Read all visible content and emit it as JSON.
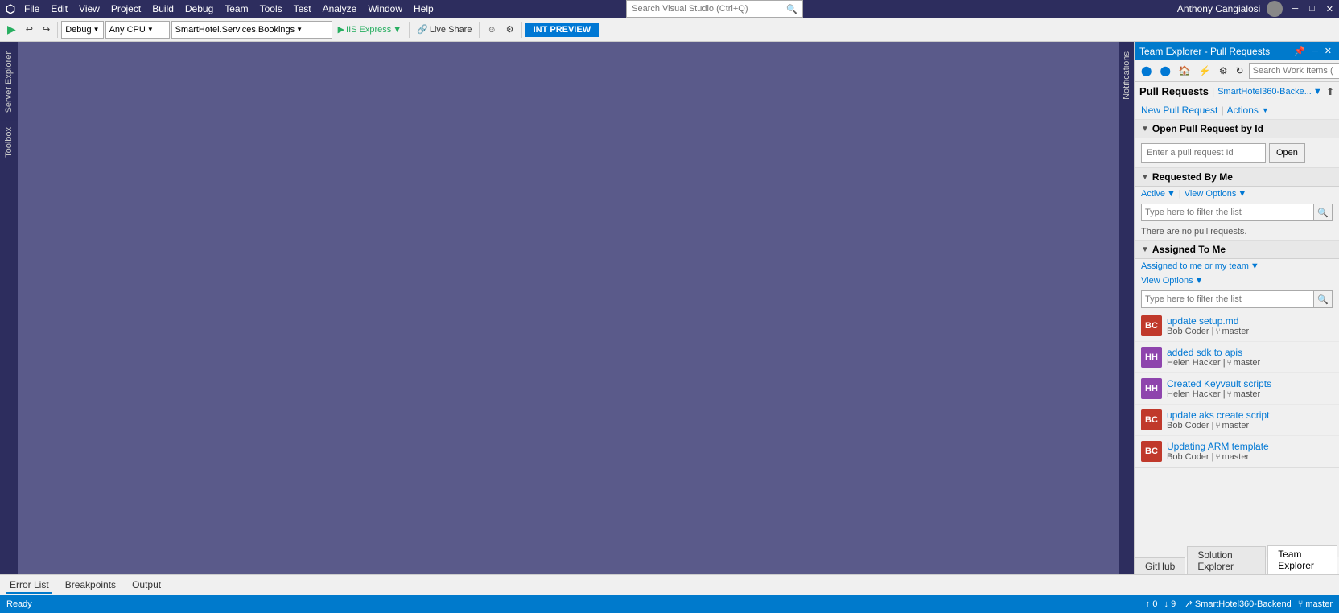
{
  "menubar": {
    "logo": "⬡",
    "items": [
      "File",
      "Edit",
      "View",
      "Project",
      "Build",
      "Debug",
      "Team",
      "Tools",
      "Test",
      "Analyze",
      "Window",
      "Help"
    ],
    "search_placeholder": "Search Visual Studio (Ctrl+Q)",
    "user": "Anthony Cangialosi",
    "int_preview": "INT PREVIEW"
  },
  "toolbar": {
    "debug_config": "Debug",
    "platform": "Any CPU",
    "project": "SmartHotel.Services.Bookings",
    "run_label": "IIS Express",
    "live_share": "Live Share"
  },
  "team_explorer": {
    "header_title": "Team Explorer - Pull Requests",
    "search_placeholder": "Search Work Items (",
    "title": "Pull Requests",
    "repo": "SmartHotel360-Backe...",
    "new_pr_link": "New Pull Request",
    "actions_link": "Actions",
    "sections": {
      "open_by_id": {
        "title": "Open Pull Request by Id",
        "input_placeholder": "Enter a pull request Id",
        "open_btn": "Open"
      },
      "requested_by_me": {
        "title": "Requested By Me",
        "filter_active": "Active",
        "filter_view_options": "View Options",
        "filter_placeholder": "Type here to filter the list",
        "no_prs_text": "There are no pull requests."
      },
      "assigned_to_me": {
        "title": "Assigned To Me",
        "filter_assigned": "Assigned to me or my team",
        "filter_view_options": "View Options",
        "filter_placeholder": "Type here to filter the list",
        "items": [
          {
            "initials": "BC",
            "color": "#c0392b",
            "title": "update setup.md",
            "author": "Bob Coder",
            "branch": "master"
          },
          {
            "initials": "HH",
            "color": "#8e44ad",
            "title": "added sdk to apis",
            "author": "Helen Hacker",
            "branch": "master"
          },
          {
            "initials": "HH",
            "color": "#8e44ad",
            "title": "Created Keyvault scripts",
            "author": "Helen Hacker",
            "branch": "master"
          },
          {
            "initials": "BC",
            "color": "#c0392b",
            "title": "update aks create script",
            "author": "Bob Coder",
            "branch": "master"
          },
          {
            "initials": "BC",
            "color": "#c0392b",
            "title": "Updating ARM template",
            "author": "Bob Coder",
            "branch": "master"
          }
        ]
      }
    }
  },
  "bottom_tabs": {
    "te_tabs": [
      "GitHub",
      "Solution Explorer",
      "Team Explorer"
    ]
  },
  "tool_windows": {
    "tabs": [
      "Error List",
      "Breakpoints",
      "Output"
    ]
  },
  "status_bar": {
    "ready": "Ready",
    "arrows_up": "0",
    "arrows_down": "9",
    "repo": "SmartHotel360-Backend",
    "branch": "master"
  }
}
